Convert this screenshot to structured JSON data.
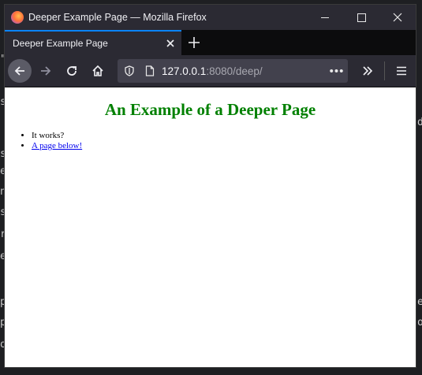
{
  "window": {
    "title": "Deeper Example Page — Mozilla Firefox"
  },
  "tab": {
    "label": "Deeper Example Page"
  },
  "urlbar": {
    "host": "127.0.0.1",
    "path": ":8080/deep/"
  },
  "page": {
    "heading": "An Example of a Deeper Page",
    "items": [
      {
        "text": "It works?",
        "is_link": false
      },
      {
        "text": "A page below!",
        "is_link": true
      }
    ]
  },
  "colors": {
    "heading": "#008000",
    "link": "#0000ee",
    "tab_accent": "#0a84ff"
  },
  "icons": {
    "app": "firefox-icon",
    "back": "back-arrow-icon",
    "forward": "forward-arrow-icon",
    "reload": "reload-icon",
    "home": "home-icon",
    "tracking": "shield-icon",
    "page": "page-icon",
    "more": "ellipsis-icon",
    "overflow": "chevron-double-right-icon",
    "menu": "hamburger-menu-icon"
  }
}
